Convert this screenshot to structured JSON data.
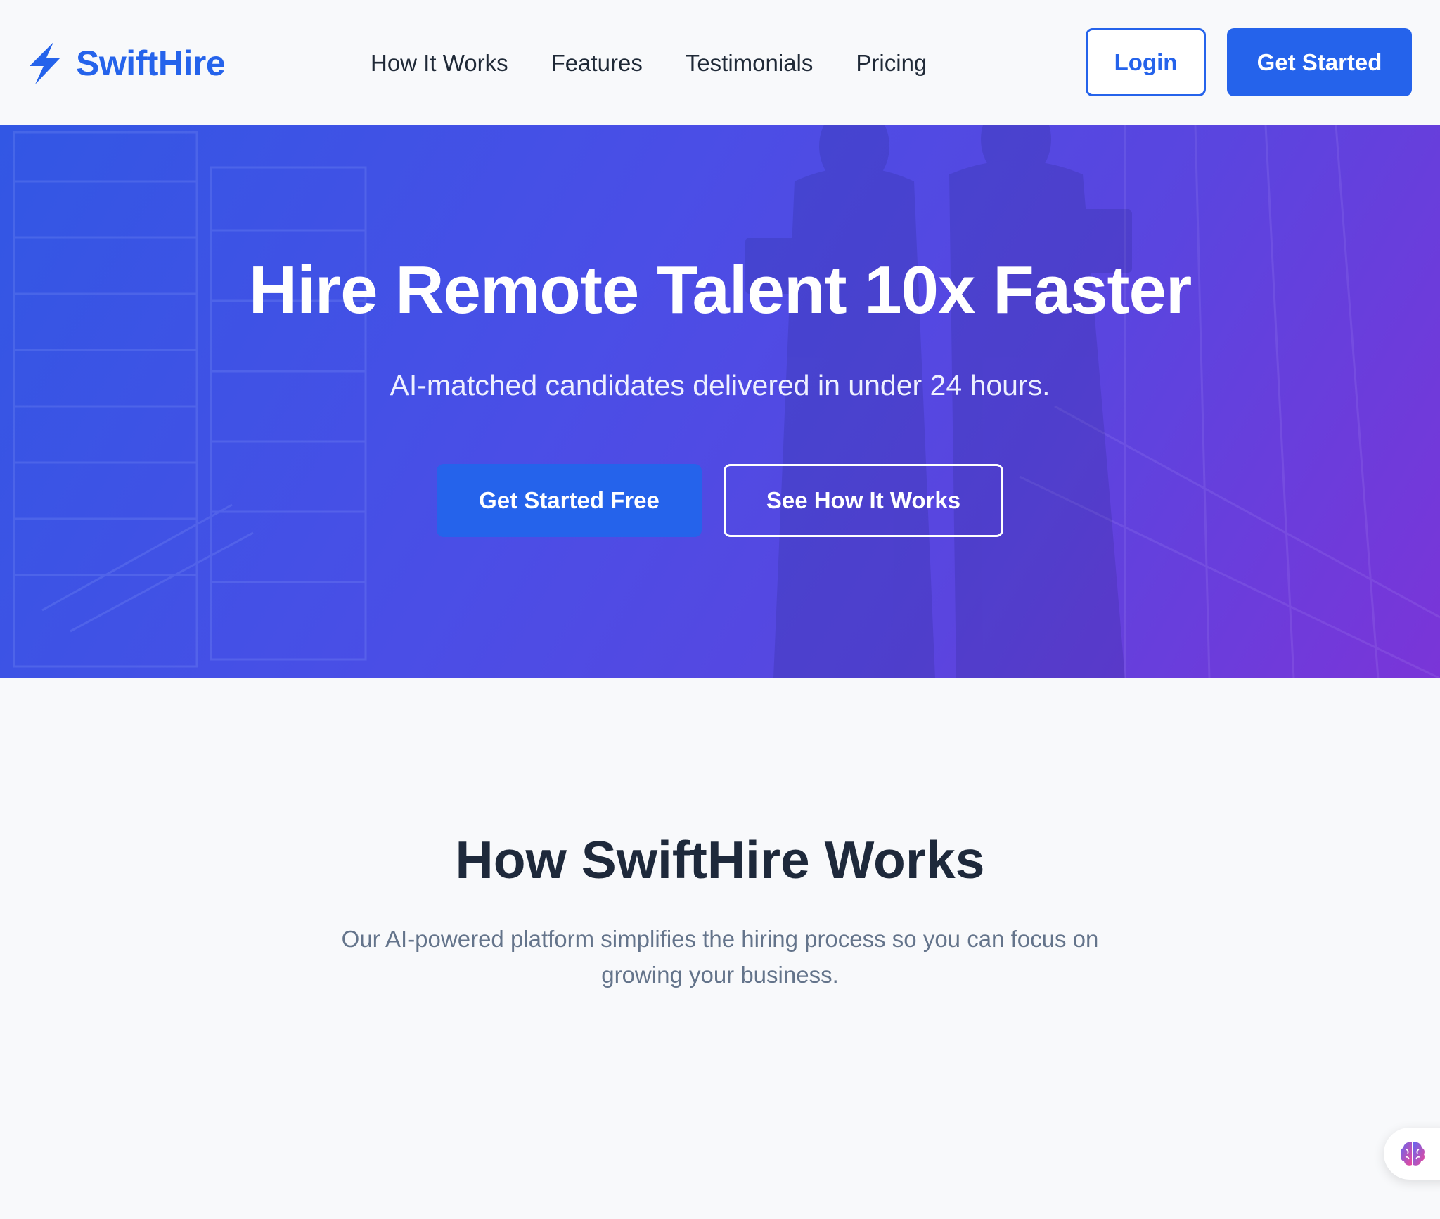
{
  "header": {
    "brand": "SwiftHire",
    "nav": [
      "How It Works",
      "Features",
      "Testimonials",
      "Pricing"
    ],
    "login_label": "Login",
    "get_started_label": "Get Started"
  },
  "hero": {
    "title": "Hire Remote Talent 10x Faster",
    "subtitle": "AI-matched candidates delivered in under 24 hours.",
    "primary_cta": "Get Started Free",
    "secondary_cta": "See How It Works"
  },
  "how_it_works": {
    "title": "How SwiftHire Works",
    "description": "Our AI-powered platform simplifies the hiring process so you can focus on growing your business."
  },
  "icons": {
    "brand": "lightning-bolt-icon",
    "widget": "brain-icon"
  },
  "colors": {
    "primary": "#2563eb",
    "hero_gradient_start": "#3257e4",
    "hero_gradient_end": "#7a35d8",
    "heading": "#1e293b",
    "muted_text": "#64748b",
    "page_background": "#f8f9fb"
  }
}
